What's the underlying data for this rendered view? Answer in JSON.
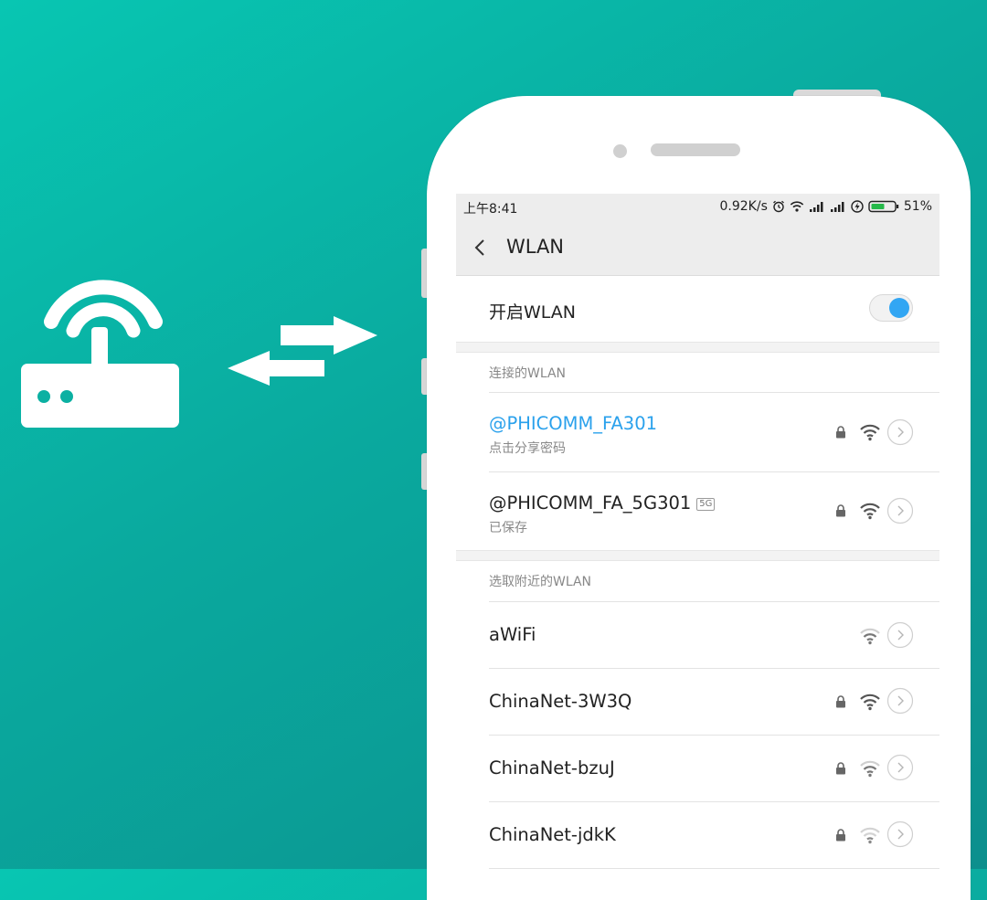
{
  "status": {
    "time": "上午8:41",
    "speed": "0.92K/s",
    "battery": "51%"
  },
  "appbar": {
    "title": "WLAN"
  },
  "toggle": {
    "label": "开启WLAN",
    "on": true
  },
  "sections": {
    "connected": "连接的WLAN",
    "nearby": "选取附近的WLAN"
  },
  "connected": [
    {
      "name": "@PHICOMM_FA301",
      "sub": "点击分享密码",
      "active": true,
      "locked": true,
      "signal": "full"
    },
    {
      "name": "@PHICOMM_FA_5G301",
      "badge": "5G",
      "sub": "已保存",
      "active": false,
      "locked": true,
      "signal": "full"
    }
  ],
  "nearby": [
    {
      "name": "aWiFi",
      "locked": false,
      "signal": "medium"
    },
    {
      "name": "ChinaNet-3W3Q",
      "locked": true,
      "signal": "full"
    },
    {
      "name": "ChinaNet-bzuJ",
      "locked": true,
      "signal": "medium"
    },
    {
      "name": "ChinaNet-jdkK",
      "locked": true,
      "signal": "weak"
    }
  ],
  "colors": {
    "accent": "#2aa1ec",
    "toggle": "#32a6f3",
    "bg_start": "#08c6b2",
    "bg_end": "#0c8f8d"
  },
  "icons": {
    "router": "router-icon",
    "transfer": "transfer-arrows-icon",
    "back": "back-chevron-icon",
    "lock": "lock-icon",
    "wifi": "wifi-signal-icon",
    "detail": "detail-chevron-icon"
  }
}
